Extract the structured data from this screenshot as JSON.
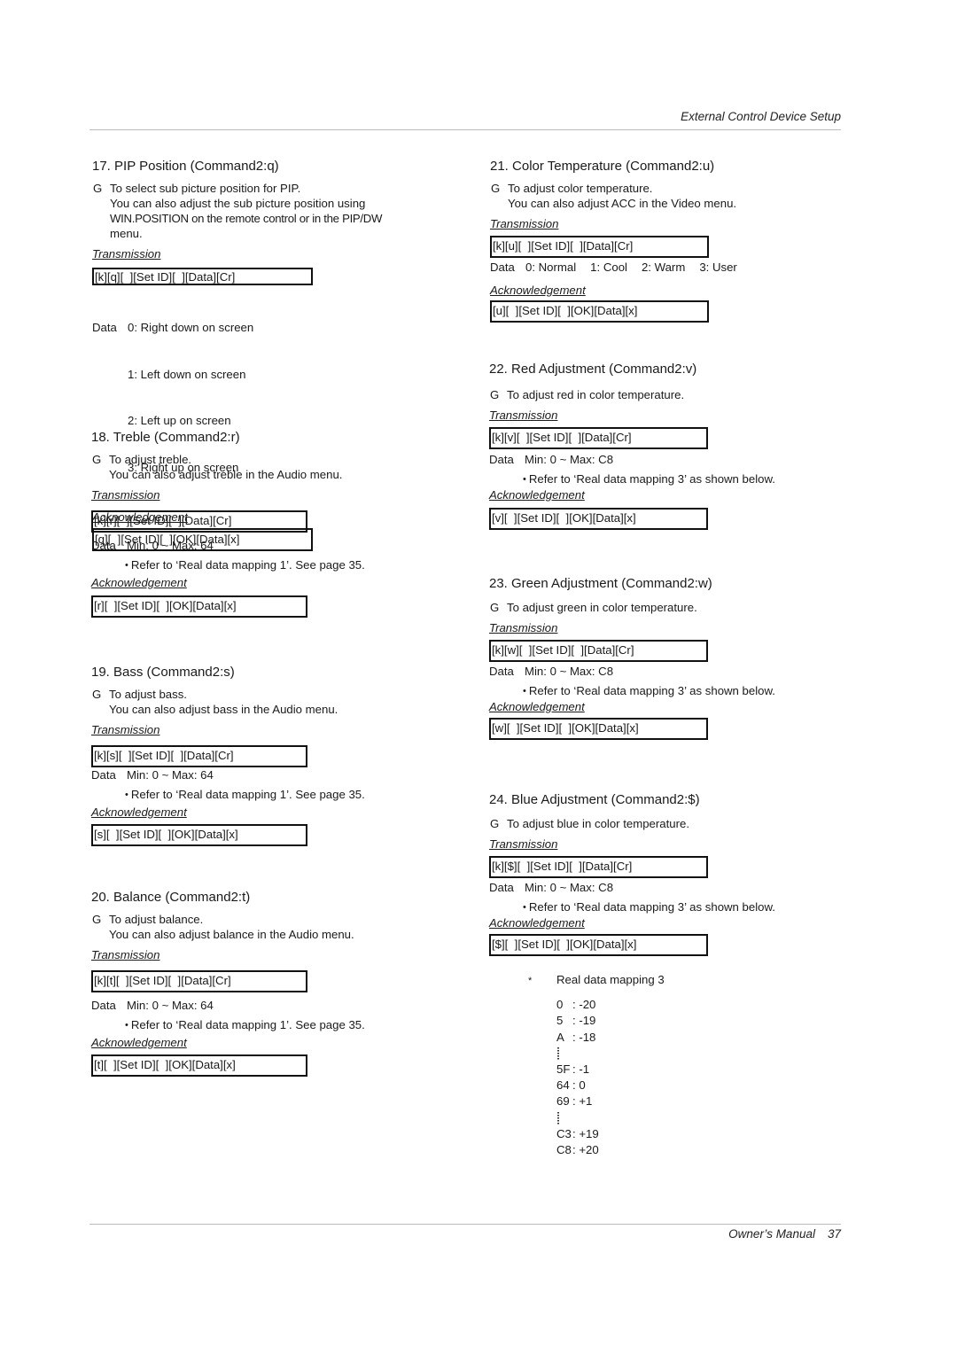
{
  "header": {
    "title": "External Control Device Setup"
  },
  "footer": {
    "label": "Owner’s Manual",
    "page": "37"
  },
  "sections": {
    "s17": {
      "heading": "17. PIP Position (Command2:q)",
      "bullet": "G",
      "desc_lines": [
        "To select sub picture position for PIP.",
        "You can also adjust the sub picture position using",
        "WIN.POSITION on the remote control or in the PIP/DW",
        "menu."
      ],
      "tx_label": "Transmission",
      "tx": "[k][q][  ][Set ID][  ][Data][Cr]",
      "data_label": "Data",
      "options": [
        "0: Right down on screen",
        "1: Left down on screen",
        "2: Left up on screen",
        "3: Right up on screen"
      ],
      "ack_label": "Acknowledgement",
      "ack": "[q][  ][Set ID][  ][OK][Data][x]"
    },
    "s18": {
      "heading": "18. Treble (Command2:r)",
      "bullet": "G",
      "desc_lines": [
        "To adjust treble.",
        "You can also adjust treble in the Audio menu."
      ],
      "tx_label": "Transmission",
      "tx": "[k][r][  ][Set ID][  ][Data][Cr]",
      "data_label": "Data",
      "range": "Min: 0 ~ Max: 64",
      "note": "Refer to ‘Real data mapping 1’. See page 35.",
      "ack_label": "Acknowledgement",
      "ack": "[r][  ][Set ID][  ][OK][Data][x]"
    },
    "s19": {
      "heading": "19. Bass (Command2:s)",
      "bullet": "G",
      "desc_lines": [
        "To adjust bass.",
        "You can also adjust bass in the Audio menu."
      ],
      "tx_label": "Transmission",
      "tx": "[k][s][  ][Set ID][  ][Data][Cr]",
      "data_label": "Data",
      "range": "Min: 0 ~ Max: 64",
      "note": "Refer to ‘Real data mapping 1’. See page 35.",
      "ack_label": "Acknowledgement",
      "ack": "[s][  ][Set ID][  ][OK][Data][x]"
    },
    "s20": {
      "heading": "20. Balance (Command2:t)",
      "bullet": "G",
      "desc_lines": [
        "To adjust balance.",
        "You can also adjust balance in the Audio menu."
      ],
      "tx_label": "Transmission",
      "tx": "[k][t][  ][Set ID][  ][Data][Cr]",
      "data_label": "Data",
      "range": "Min: 0 ~ Max: 64",
      "note": "Refer to ‘Real data mapping 1’. See page 35.",
      "ack_label": "Acknowledgement",
      "ack": "[t][  ][Set ID][  ][OK][Data][x]"
    },
    "s21": {
      "heading": "21. Color Temperature (Command2:u)",
      "bullet": "G",
      "desc_lines": [
        "To adjust color temperature.",
        "You can also adjust ACC in the Video menu."
      ],
      "tx_label": "Transmission",
      "tx": "[k][u][  ][Set ID][  ][Data][Cr]",
      "data_label": "Data",
      "options": [
        "0: Normal",
        "1: Cool",
        "2: Warm",
        "3: User"
      ],
      "ack_label": "Acknowledgement",
      "ack": "[u][  ][Set ID][  ][OK][Data][x]"
    },
    "s22": {
      "heading": "22. Red Adjustment (Command2:v)",
      "bullet": "G",
      "desc_lines": [
        "To adjust red in color temperature."
      ],
      "tx_label": "Transmission",
      "tx": "[k][v][  ][Set ID][  ][Data][Cr]",
      "data_label": "Data",
      "range": "Min: 0 ~ Max: C8",
      "note": "Refer to ‘Real data mapping 3’ as shown below.",
      "ack_label": "Acknowledgement",
      "ack": "[v][  ][Set ID][  ][OK][Data][x]"
    },
    "s23": {
      "heading": "23. Green Adjustment (Command2:w)",
      "bullet": "G",
      "desc_lines": [
        "To adjust green in color temperature."
      ],
      "tx_label": "Transmission",
      "tx": "[k][w][  ][Set ID][  ][Data][Cr]",
      "data_label": "Data",
      "range": "Min: 0 ~ Max: C8",
      "note": "Refer to ‘Real data mapping 3’ as shown below.",
      "ack_label": "Acknowledgement",
      "ack": "[w][  ][Set ID][  ][OK][Data][x]"
    },
    "s24": {
      "heading": "24. Blue Adjustment (Command2:$)",
      "bullet": "G",
      "desc_lines": [
        "To adjust blue in color temperature."
      ],
      "tx_label": "Transmission",
      "tx": "[k][$][  ][Set ID][  ][Data][Cr]",
      "data_label": "Data",
      "range": "Min: 0 ~ Max: C8",
      "note": "Refer to ‘Real data mapping 3’ as shown below.",
      "ack_label": "Acknowledgement",
      "ack": "[$][  ][Set ID][  ][OK][Data][x]"
    }
  },
  "mapping": {
    "star": "*",
    "title": "Real data mapping 3",
    "rows": [
      {
        "k": "0",
        "v": ": -20"
      },
      {
        "k": "5",
        "v": ": -19"
      },
      {
        "k": "A",
        "v": ": -18"
      },
      {
        "ellipsis": true
      },
      {
        "k": "5F",
        "v": ": -1"
      },
      {
        "k": "64",
        "v": ": 0"
      },
      {
        "k": "69",
        "v": ": +1"
      },
      {
        "ellipsis": true
      },
      {
        "k": "C3",
        "v": ": +19"
      },
      {
        "k": "C8",
        "v": ": +20"
      }
    ]
  }
}
